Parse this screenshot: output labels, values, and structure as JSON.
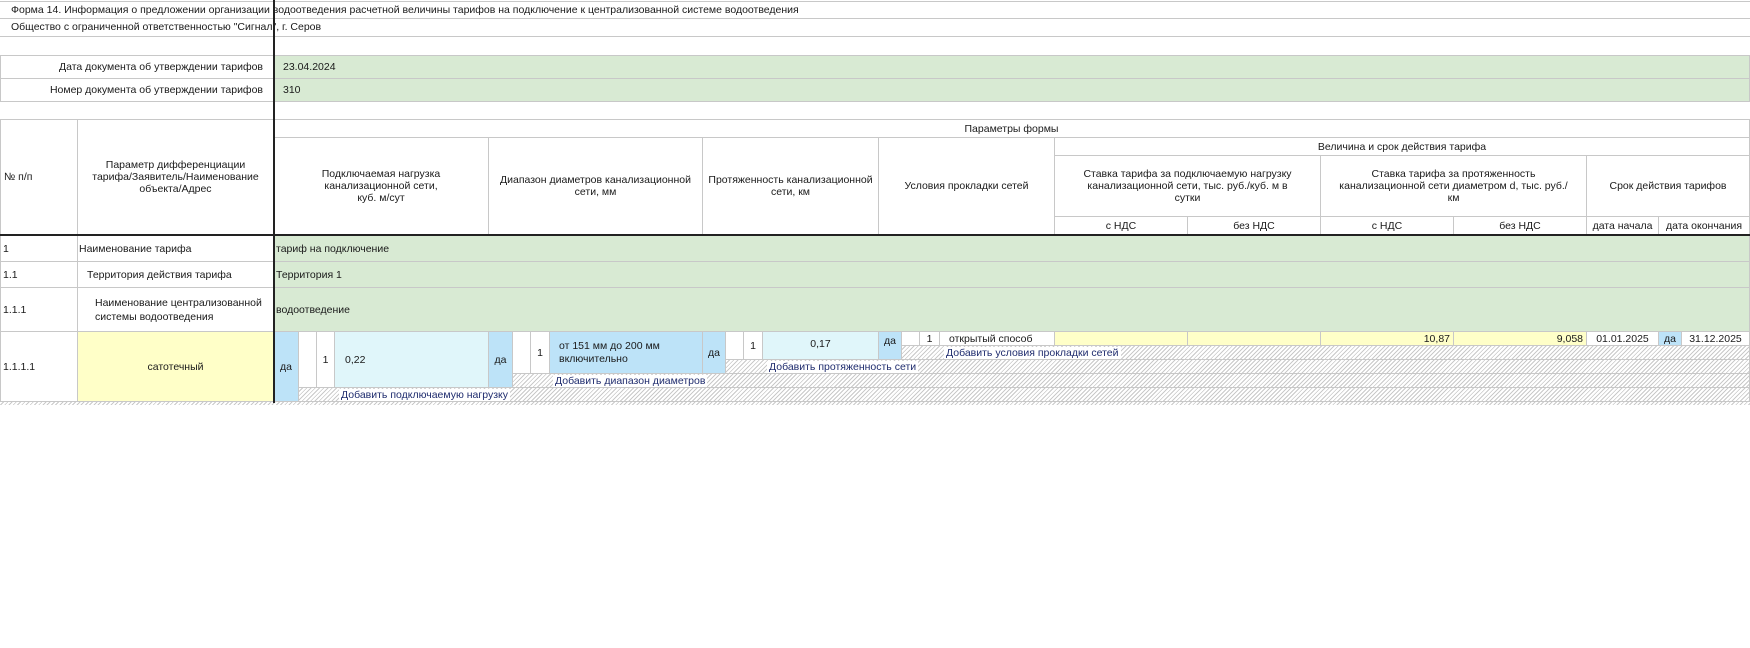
{
  "form_title": "Форма 14. Информация о предложении организации водоотведения расчетной величины тарифов на подключение к централизованной системе водоотведения",
  "org_name": "Общество с ограниченной ответственностью \"Сигнал\", г. Серов",
  "doc": {
    "date_label": "Дата документа об утверждении тарифов",
    "date_value": "23.04.2024",
    "number_label": "Номер документа об утверждении тарифов",
    "number_value": "310"
  },
  "header": {
    "params_title": "Параметры формы",
    "num_col": "№ п/п",
    "param_col": "Параметр дифференциации тарифа/Заявитель/Наименование объекта/Адрес",
    "load_col": "Подключаемая нагрузка канализационной сети, куб. м/сут",
    "diam_col": "Диапазон диаметров канализационной сети, мм",
    "length_col": "Протяженность канализационной сети, км",
    "cond_col": "Условия прокладки сетей",
    "tariff_group": "Величина и срок действия тарифа",
    "rate_load": "Ставка тарифа за подключаемую нагрузку канализационной сети, тыс. руб./куб. м в сутки",
    "rate_length": "Ставка тарифа за протяженность канализационной сети диаметром d, тыс. руб./км",
    "term": "Срок действия тарифов",
    "with_vat": "с НДС",
    "without_vat": "без НДС",
    "date_start": "дата начала",
    "date_end": "дата окончания"
  },
  "rows": {
    "r1": {
      "num": "1",
      "label": "Наименование тарифа",
      "value": "тариф на подключение"
    },
    "r2": {
      "num": "1.1",
      "label": "Территория действия тарифа",
      "value": "Территория 1"
    },
    "r3": {
      "num": "1.1.1",
      "label": "Наименование централизованной системы водоотведения",
      "value": "водоотведение"
    },
    "r4": {
      "num": "1.1.1.1",
      "label": "сатотечный",
      "load_flag": "да",
      "load_idx": "1",
      "load_value": "0,22",
      "diam_flag": "да",
      "diam_idx": "1",
      "diam_value": "от 151 мм до 200 мм включительно",
      "len_flag": "да",
      "len_idx": "1",
      "len_value": "0,17",
      "cond_flag": "да",
      "cond_idx": "1",
      "cond_value": "открытый способ",
      "rate_load_vat": "",
      "rate_load_novat": "",
      "rate_len_vat": "10,87",
      "rate_len_novat": "9,058",
      "date_start": "01.01.2025",
      "date_flag": "да",
      "date_end": "31.12.2025"
    }
  },
  "actions": {
    "add_conditions": "Добавить условия прокладки сетей",
    "add_length": "Добавить протяженность сети",
    "add_diameter": "Добавить диапазон диаметров",
    "add_load": "Добавить подключаемую нагрузку"
  }
}
